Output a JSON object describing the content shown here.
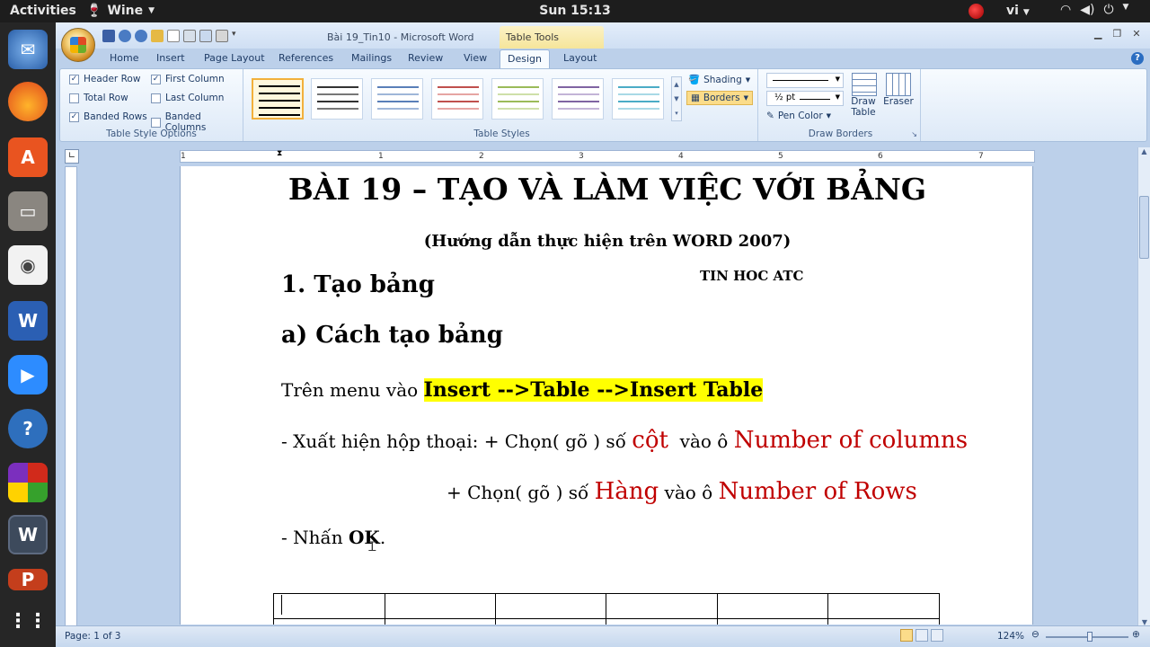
{
  "topbar": {
    "activities": "Activities",
    "app": "Wine",
    "clock": "Sun 15:13",
    "lang": "vi"
  },
  "window": {
    "title": "Bài 19_Tin10 - Microsoft Word",
    "context_tab": "Table Tools"
  },
  "tabs": [
    "Home",
    "Insert",
    "Page Layout",
    "References",
    "Mailings",
    "Review",
    "View",
    "Design",
    "Layout"
  ],
  "ribbon": {
    "style_options": {
      "label": "Table Style Options",
      "items": [
        {
          "label": "Header Row",
          "checked": true
        },
        {
          "label": "First Column",
          "checked": true
        },
        {
          "label": "Total Row",
          "checked": false
        },
        {
          "label": "Last Column",
          "checked": false
        },
        {
          "label": "Banded Rows",
          "checked": true
        },
        {
          "label": "Banded Columns",
          "checked": false
        }
      ]
    },
    "table_styles": {
      "label": "Table Styles",
      "shading": "Shading",
      "borders": "Borders"
    },
    "draw_borders": {
      "label": "Draw Borders",
      "weight": "½ pt",
      "pen_color": "Pen Color",
      "draw_table": "Draw Table",
      "eraser": "Eraser"
    }
  },
  "ruler_numbers": [
    "1",
    "1",
    "2",
    "3",
    "4",
    "5",
    "6",
    "7"
  ],
  "document": {
    "title": "BÀI 19 – TẠO VÀ LÀM VIỆC VỚI BẢNG",
    "subtitle": "(Hướng dẫn thực hiện trên WORD 2007)",
    "watermark": "TIN HOC ATC",
    "h1": "1. Tạo bảng",
    "h2": "a) Cách tạo bảng",
    "p1_prefix": "Trên menu vào ",
    "p1_highlight": "Insert -->Table -->Insert Table",
    "p2_prefix": "- Xuất hiện hộp thoại: + Chọn( gõ ) số ",
    "p2_red1": "cột",
    "p2_mid": "  vào ô ",
    "p2_red2": "Number of columns",
    "p3_prefix": "+ Chọn( gõ ) số ",
    "p3_red1": "Hàng",
    "p3_mid": " vào ô ",
    "p3_red2": "Number of Rows",
    "p4_prefix": "- Nhấn ",
    "p4_bold": "OK",
    "p4_suffix": "."
  },
  "status": {
    "page": "Page: 1 of 3",
    "zoom": "124%"
  }
}
